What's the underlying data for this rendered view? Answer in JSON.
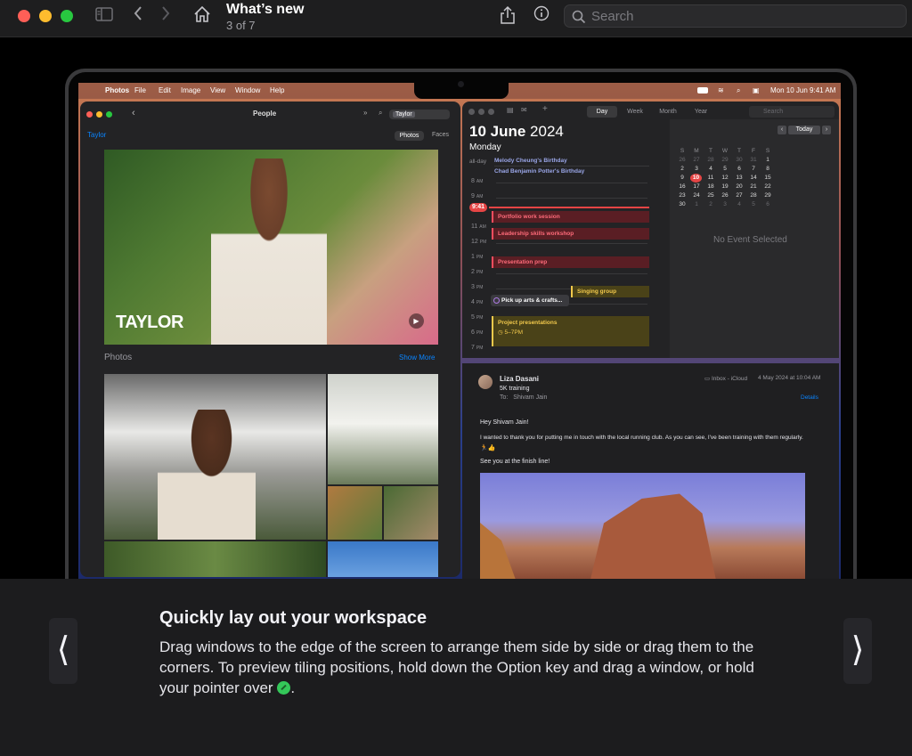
{
  "window": {
    "title": "What’s new",
    "subtitle": "3 of 7",
    "search_placeholder": "Search"
  },
  "icons": {
    "sidebar": "sidebar-icon",
    "back": "chevron-left-icon",
    "forward": "chevron-right-icon",
    "home": "home-icon",
    "share": "share-icon",
    "info": "info-icon",
    "search": "search-icon"
  },
  "colors": {
    "traffic_red": "#ff5f57",
    "traffic_yellow": "#febc2e",
    "traffic_green": "#28c840",
    "accent_blue": "#0a84ff",
    "tile_green": "#34c759"
  },
  "screen": {
    "menubar": {
      "app": "Photos",
      "items": [
        "File",
        "Edit",
        "Image",
        "View",
        "Window",
        "Help"
      ],
      "clock": "Mon 10 Jun  9:41 AM"
    },
    "photos_app": {
      "window_title": "People",
      "search_value": "Taylor",
      "person": "Taylor",
      "tabs": [
        "Photos",
        "Faces"
      ],
      "hero_label": "TAYLOR",
      "section_title": "Photos",
      "show_more": "Show More"
    },
    "calendar_app": {
      "view_tabs": [
        "Day",
        "Week",
        "Month",
        "Year"
      ],
      "search_placeholder": "Search",
      "date_bold": "10 June",
      "year": "2024",
      "weekday": "Monday",
      "today_button": "Today",
      "allday_label": "all-day",
      "allday_events": [
        "Melody Cheung's Birthday",
        "Chad Benjamin Potter's Birthday"
      ],
      "now_badge": "9:41",
      "hours": [
        "8",
        "9",
        "10",
        "11",
        "12",
        "1",
        "2",
        "3",
        "4",
        "5",
        "6",
        "7"
      ],
      "hour_suffixes": [
        "AM",
        "AM",
        "AM",
        "AM",
        "PM",
        "PM",
        "PM",
        "PM",
        "PM",
        "PM",
        "PM",
        "PM"
      ],
      "events": [
        {
          "title": "Portfolio work session"
        },
        {
          "title": "Leadership skills workshop"
        },
        {
          "title": "Presentation prep"
        },
        {
          "title": "Singing group"
        },
        {
          "title": "Pick up arts & crafts..."
        },
        {
          "title": "Project presentations",
          "time": "5–7PM"
        }
      ],
      "mini_weekdays": [
        "S",
        "M",
        "T",
        "W",
        "T",
        "F",
        "S"
      ],
      "mini_weeks": [
        [
          "26",
          "27",
          "28",
          "29",
          "30",
          "31",
          "1"
        ],
        [
          "2",
          "3",
          "4",
          "5",
          "6",
          "7",
          "8"
        ],
        [
          "9",
          "10",
          "11",
          "12",
          "13",
          "14",
          "15"
        ],
        [
          "16",
          "17",
          "18",
          "19",
          "20",
          "21",
          "22"
        ],
        [
          "23",
          "24",
          "25",
          "26",
          "27",
          "28",
          "29"
        ],
        [
          "30",
          "1",
          "2",
          "3",
          "4",
          "5",
          "6"
        ]
      ],
      "no_event": "No Event Selected"
    },
    "mail_app": {
      "sender": "Liza Dasani",
      "subject": "5K training",
      "to_label": "To:",
      "to_name": "Shivam Jain",
      "mailbox": "Inbox - iCloud",
      "date": "4 May 2024 at 10:04 AM",
      "details": "Details",
      "greeting": "Hey Shivam Jain!",
      "body_line": "I wanted to thank you for putting me in touch with the local running club. As you can see, I've been training with them regularly.",
      "body_emoji": "🏃👍",
      "closing": "See you at the finish line!"
    }
  },
  "feature": {
    "title": "Quickly lay out your workspace",
    "body": "Drag windows to the edge of the screen to arrange them side by side or drag them to the corners. To preview tiling positions, hold down the Option key and drag a window, or hold your pointer over",
    "body_end": ".",
    "prev_label": "⟨",
    "next_label": "⟩"
  }
}
